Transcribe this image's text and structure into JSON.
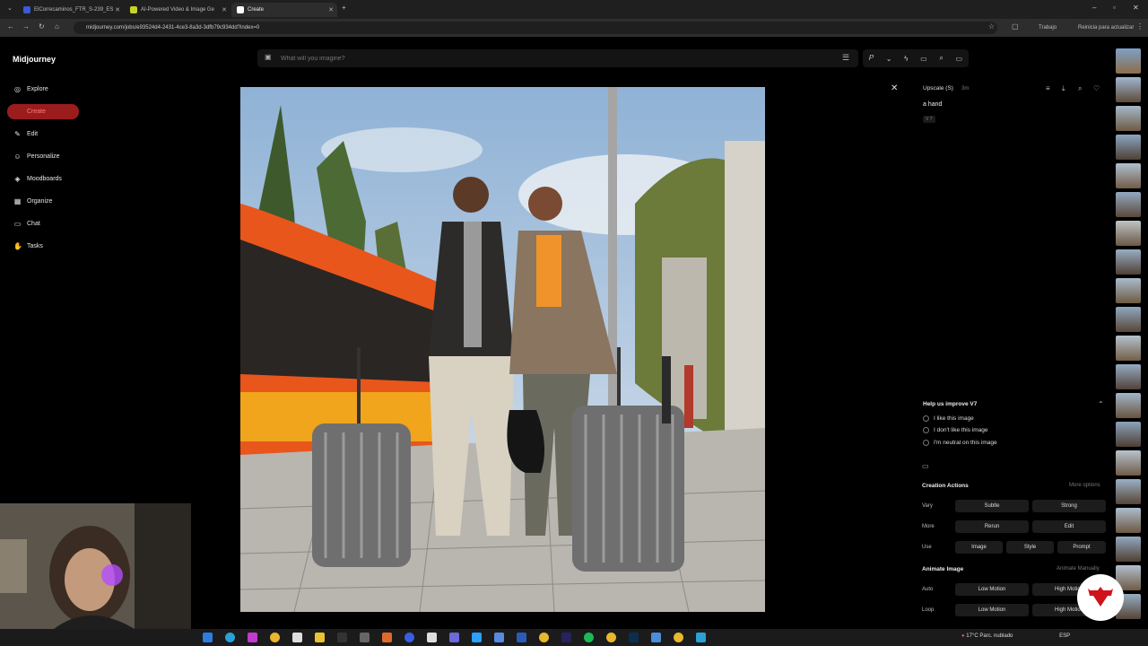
{
  "browser": {
    "tabs": [
      {
        "label": "ElCorrecaminos_FTR_S-239_ES"
      },
      {
        "label": "AI-Powered Video & Image Ge"
      },
      {
        "label": "Create"
      }
    ],
    "url": "midjourney.com/jobs/e93524d4-2431-4ce3-8a3d-3dfb79c934dd?index=0",
    "profile_label": "Trabajo",
    "update_label": "Reinicia para actualizar"
  },
  "sidebar": {
    "brand": "Midjourney",
    "items": [
      {
        "label": "Explore",
        "icon": "compass-icon"
      },
      {
        "label": "Create",
        "icon": "brush-icon"
      },
      {
        "label": "Edit",
        "icon": "edit-icon"
      },
      {
        "label": "Personalize",
        "icon": "user-icon"
      },
      {
        "label": "Moodboards",
        "icon": "layers-icon"
      },
      {
        "label": "Organize",
        "icon": "grid-icon"
      },
      {
        "label": "Chat",
        "icon": "chat-icon"
      },
      {
        "label": "Tasks",
        "icon": "thumb-icon"
      }
    ]
  },
  "search": {
    "placeholder": "What will you imagine?"
  },
  "panel": {
    "title": "Upscale (S)",
    "time": "3m",
    "prompt": "a hand",
    "version_tag": "V 7",
    "improve_title": "Help us improve V7",
    "options": [
      "I like this image",
      "I don't like this image",
      "I'm neutral on this image"
    ],
    "creation_title": "Creation Actions",
    "more_options": "More options",
    "rows": [
      {
        "label": "Vary",
        "buttons": [
          "Subtle",
          "Strong"
        ]
      },
      {
        "label": "More",
        "buttons": [
          "Rerun",
          "Edit"
        ]
      },
      {
        "label": "Use",
        "buttons": [
          "Image",
          "Style",
          "Prompt"
        ]
      }
    ],
    "animate_title": "Animate Image",
    "animate_manual": "Animate Manually",
    "animate_rows": [
      {
        "label": "Auto",
        "buttons": [
          "Low Motion",
          "High Motion"
        ]
      },
      {
        "label": "Loop",
        "buttons": [
          "Low Motion",
          "High Motion"
        ]
      }
    ]
  },
  "taskbar": {
    "weather": "17°C Parc. nublado",
    "lang": "ESP"
  },
  "colors": {
    "accent": "#9b1c1c",
    "accent_text": "#ff7b7b",
    "bg": "#000000"
  }
}
